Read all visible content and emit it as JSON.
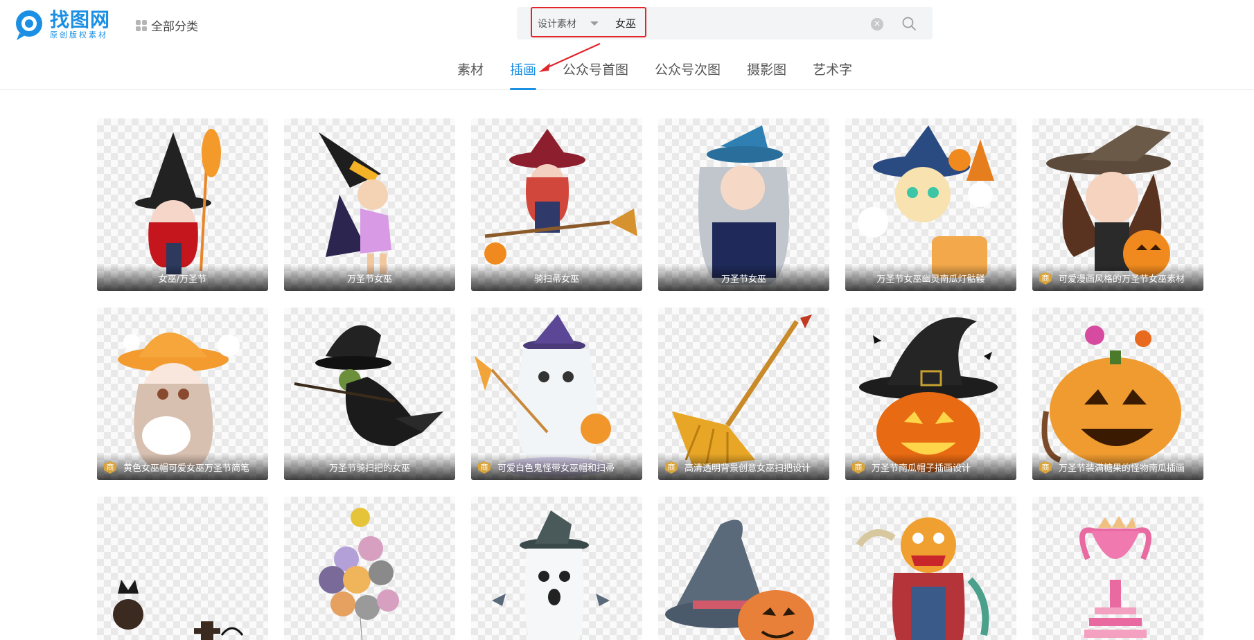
{
  "logo": {
    "name": "找图网",
    "subtitle": "原创版权素材",
    "brand_color": "#1a8fe3"
  },
  "all_categories": {
    "label": "全部分类",
    "icon": "grid-icon"
  },
  "search": {
    "type_label": "设计素材",
    "value": "女巫",
    "clear_icon": "close-circle-icon",
    "search_icon": "search-icon",
    "highlight_color": "#e0252b"
  },
  "tabs": [
    {
      "label": "素材",
      "active": false
    },
    {
      "label": "插画",
      "active": true
    },
    {
      "label": "公众号首图",
      "active": false
    },
    {
      "label": "公众号次图",
      "active": false
    },
    {
      "label": "摄影图",
      "active": false
    },
    {
      "label": "艺术字",
      "active": false
    }
  ],
  "badge_label": "商",
  "rows": [
    [
      {
        "title": "女巫/万圣节",
        "badge": false
      },
      {
        "title": "万圣节女巫",
        "badge": false
      },
      {
        "title": "骑扫帚女巫",
        "badge": false
      },
      {
        "title": "万圣节女巫",
        "badge": false
      },
      {
        "title": "万圣节女巫幽灵南瓜灯骷髅",
        "badge": false
      },
      {
        "title": "可爱漫画风格的万圣节女巫素材",
        "badge": true
      }
    ],
    [
      {
        "title": "黄色女巫帽可爱女巫万圣节简笔",
        "badge": true
      },
      {
        "title": "万圣节骑扫把的女巫",
        "badge": false
      },
      {
        "title": "可爱白色鬼怪带女巫帽和扫帚",
        "badge": true
      },
      {
        "title": "高清透明背景创意女巫扫把设计",
        "badge": true
      },
      {
        "title": "万圣节南瓜帽子插画设计",
        "badge": true
      },
      {
        "title": "万圣节装满糖果的怪物南瓜插画",
        "badge": true
      }
    ],
    [
      {
        "title": "",
        "badge": false
      },
      {
        "title": "",
        "badge": false
      },
      {
        "title": "",
        "badge": false
      },
      {
        "title": "",
        "badge": false
      },
      {
        "title": "",
        "badge": false
      },
      {
        "title": "",
        "badge": false
      }
    ]
  ]
}
